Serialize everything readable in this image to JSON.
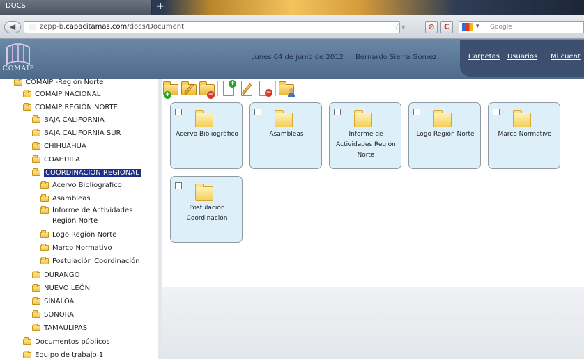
{
  "browser": {
    "tab_title": "DOCS",
    "new_tab": "+",
    "url_prefix": "zepp-b.",
    "url_host": "capacitamas.com",
    "url_path": "/docs/Document",
    "search_placeholder": "Google"
  },
  "header": {
    "logo_text": "COMAIP",
    "date": "Lunes 04 de junio de 2012",
    "user": "Bernardo Sierra Gómez",
    "nav": [
      "Carpetas",
      "Usuarios",
      "Mi cuent"
    ]
  },
  "tree": {
    "root": "COMAIP -Región Norte",
    "nacional": "COMAIP NACIONAL",
    "region_norte": "COMAIP REGIÓN NORTE",
    "states": [
      "BAJA CALIFORNIA",
      "BAJA CALIFORNIA SUR",
      "CHIHUAHUA",
      "COAHUILA"
    ],
    "selected": "COORDINACIÓN REGIONAL",
    "children": [
      "Acervo Bibliográfico",
      "Asambleas",
      "Informe de Actividades Región Norte",
      "Logo Región Norte",
      "Marco Normativo",
      "Postulación Coordinación"
    ],
    "states_after": [
      "DURANGO",
      "NUEVO LEÓN",
      "SINALOA",
      "SONORA",
      "TAMAULIPAS"
    ],
    "public": "Documentos públicos",
    "team": "Equipo de trabajo 1"
  },
  "toolbar": {
    "icons": [
      "new-folder-icon",
      "edit-folder-icon",
      "delete-folder-icon",
      "new-document-icon",
      "edit-document-icon",
      "delete-document-icon",
      "folder-permissions-icon"
    ]
  },
  "folders": [
    {
      "name": "Acervo Bibliográfico"
    },
    {
      "name": "Asambleas"
    },
    {
      "name": "Informe de Actividades Región Norte"
    },
    {
      "name": "Logo Región Norte"
    },
    {
      "name": "Marco Normativo"
    },
    {
      "name": "Postulación Coordinación"
    }
  ],
  "colors": {
    "header_bg": "#5f7b9b",
    "nav_bg": "#3c4f6e",
    "selected_bg": "#1d2f86",
    "card_bg": "#ddf0fa"
  }
}
